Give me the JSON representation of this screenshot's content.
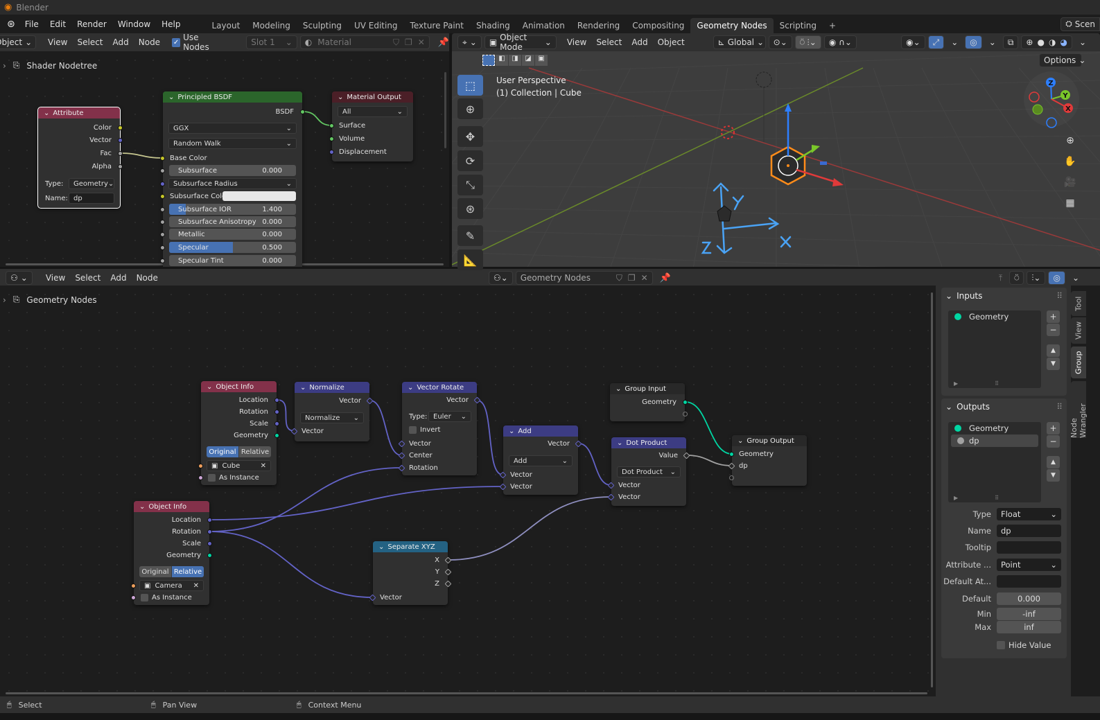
{
  "app": {
    "title": "Blender",
    "logo_icon": "blender-logo-icon"
  },
  "topbar": {
    "menus": [
      "File",
      "Edit",
      "Render",
      "Window",
      "Help"
    ],
    "workspaces": [
      "Layout",
      "Modeling",
      "Sculpting",
      "UV Editing",
      "Texture Paint",
      "Shading",
      "Animation",
      "Rendering",
      "Compositing",
      "Geometry Nodes",
      "Scripting"
    ],
    "active_workspace": "Geometry Nodes",
    "add_workspace": "+",
    "scene": "Scen"
  },
  "shader_editor": {
    "header": {
      "editor_mode": "Object",
      "menus": [
        "View",
        "Select",
        "Add",
        "Node"
      ],
      "use_nodes_label": "Use Nodes",
      "use_nodes": true,
      "slot": "Slot 1",
      "material_placeholder": "Material"
    },
    "breadcrumb": "Shader Nodetree",
    "nodes": {
      "attribute": {
        "title": "Attribute",
        "rows": [
          {
            "label": "Color"
          },
          {
            "label": "Vector"
          },
          {
            "label": "Fac"
          },
          {
            "label": "Alpha"
          },
          {
            "label": "Type:",
            "value": "Geometry"
          },
          {
            "label": "Name:",
            "value": "dp"
          }
        ]
      },
      "principled": {
        "title": "Principled BSDF",
        "rows": [
          {
            "label": "BSDF"
          },
          {
            "value": "GGX"
          },
          {
            "value": "Random Walk"
          },
          {
            "label": "Base Color"
          },
          {
            "label": "Subsurface",
            "value": "0.000",
            "fill": 0
          },
          {
            "value": "Subsurface Radius"
          },
          {
            "label": "Subsurface Color",
            "value": "#e8e8e8"
          },
          {
            "label": "Subsurface IOR",
            "value": "1.400",
            "fill": 0.13
          },
          {
            "label": "Subsurface Anisotropy",
            "value": "0.000",
            "fill": 0
          },
          {
            "label": "Metallic",
            "value": "0.000",
            "fill": 0
          },
          {
            "label": "Specular",
            "value": "0.500",
            "fill": 0.5
          },
          {
            "label": "Specular Tint",
            "value": "0.000",
            "fill": 0
          }
        ]
      },
      "material_output": {
        "title": "Material Output",
        "rows": [
          {
            "value": "All"
          },
          {
            "label": "Surface"
          },
          {
            "label": "Volume"
          },
          {
            "label": "Displacement"
          }
        ]
      }
    }
  },
  "viewport": {
    "header": {
      "mode": "Object Mode",
      "menus": [
        "View",
        "Select",
        "Add",
        "Object"
      ],
      "transform_orientation": "Global",
      "options": "Options"
    },
    "overlay": {
      "perspective": "User Perspective",
      "collection": "(1) Collection | Cube"
    },
    "gizmo": {
      "x": "X",
      "y": "Y",
      "z": "Z"
    },
    "tools": [
      "select-box-icon",
      "cursor-icon",
      "move-icon",
      "rotate-icon",
      "scale-icon",
      "transform-icon",
      "annotate-icon",
      "measure-icon"
    ],
    "active_tool": "select-box-icon"
  },
  "geometry_editor": {
    "header": {
      "menus": [
        "View",
        "Select",
        "Add",
        "Node"
      ],
      "node_tree": "Geometry Nodes"
    },
    "breadcrumb": "Geometry Nodes",
    "nodes": {
      "object_info_1": {
        "title": "Object Info",
        "rows": [
          {
            "label": "Location"
          },
          {
            "label": "Rotation"
          },
          {
            "label": "Scale"
          },
          {
            "label": "Geometry"
          },
          {
            "options": [
              "Original",
              "Relative"
            ],
            "active": 0
          },
          {
            "value": "Cube"
          },
          {
            "label": "As Instance"
          }
        ]
      },
      "normalize": {
        "title": "Normalize",
        "rows": [
          {
            "label": "Vector"
          },
          {
            "value": "Normalize"
          },
          {
            "label": "Vector"
          }
        ]
      },
      "vector_rotate": {
        "title": "Vector Rotate",
        "rows": [
          {
            "label": "Vector"
          },
          {
            "label": "Type:",
            "value": "Euler"
          },
          {
            "label": "Invert"
          },
          {
            "label": "Vector"
          },
          {
            "label": "Center"
          },
          {
            "label": "Rotation"
          }
        ]
      },
      "add": {
        "title": "Add",
        "rows": [
          {
            "label": "Vector"
          },
          {
            "value": "Add"
          },
          {
            "label": "Vector"
          },
          {
            "label": "Vector"
          }
        ]
      },
      "dot_product": {
        "title": "Dot Product",
        "rows": [
          {
            "label": "Value"
          },
          {
            "value": "Dot Product"
          },
          {
            "label": "Vector"
          },
          {
            "label": "Vector"
          }
        ]
      },
      "group_input": {
        "title": "Group Input",
        "rows": [
          {
            "label": "Geometry"
          },
          {}
        ]
      },
      "group_output": {
        "title": "Group Output",
        "rows": [
          {
            "label": "Geometry"
          },
          {
            "label": "dp"
          },
          {}
        ]
      },
      "separate_xyz": {
        "title": "Separate XYZ",
        "rows": [
          {
            "label": "X"
          },
          {
            "label": "Y"
          },
          {
            "label": "Z"
          },
          {
            "label": "Vector"
          }
        ]
      },
      "object_info_2": {
        "title": "Object Info",
        "rows": [
          {
            "label": "Location"
          },
          {
            "label": "Rotation"
          },
          {
            "label": "Scale"
          },
          {
            "label": "Geometry"
          },
          {
            "options": [
              "Original",
              "Relative"
            ],
            "active": 1
          },
          {
            "value": "Camera"
          },
          {
            "label": "As Instance"
          }
        ]
      }
    },
    "sidebar": {
      "tabs": [
        "Tool",
        "View",
        "Group",
        "Node Wrangler"
      ],
      "active_tab": "Group",
      "inputs": {
        "title": "Inputs",
        "items": [
          {
            "name": "Geometry",
            "color": "#00d6a3"
          }
        ]
      },
      "outputs": {
        "title": "Outputs",
        "items": [
          {
            "name": "Geometry",
            "color": "#00d6a3"
          },
          {
            "name": "dp",
            "color": "#a1a1a1"
          }
        ],
        "selected": "dp"
      },
      "properties": {
        "type_label": "Type",
        "type": "Float",
        "name_label": "Name",
        "name": "dp",
        "tooltip_label": "Tooltip",
        "tooltip": "",
        "attribute_domain_label": "Attribute ...",
        "attribute_domain": "Point",
        "default_attribute_label": "Default At...",
        "default_attribute": "",
        "default_label": "Default",
        "default": "0.000",
        "min_label": "Min",
        "min": "-inf",
        "max_label": "Max",
        "max": "inf",
        "hide_value_label": "Hide Value",
        "hide_value": false
      }
    }
  },
  "statusbar": {
    "items": [
      {
        "icon": "mouse-left-icon",
        "label": "Select"
      },
      {
        "icon": "mouse-middle-icon",
        "label": "Pan View"
      },
      {
        "icon": "mouse-right-icon",
        "label": "Context Menu"
      }
    ]
  },
  "colors": {
    "accent": "#4772b3",
    "geometry_socket": "#00d6a3",
    "vector_socket": "#6363c7",
    "float_socket": "#a1a1a1",
    "color_socket": "#c7c729",
    "shader_socket": "#63c763",
    "object_socket": "#ed9e5c",
    "boolean_socket": "#cca6d6",
    "object_info_header": "#83314a",
    "vector_header": "#3c3c83",
    "converter_header": "#246283",
    "shader_header": "#2b652b",
    "output_header": "#4b1f27"
  }
}
